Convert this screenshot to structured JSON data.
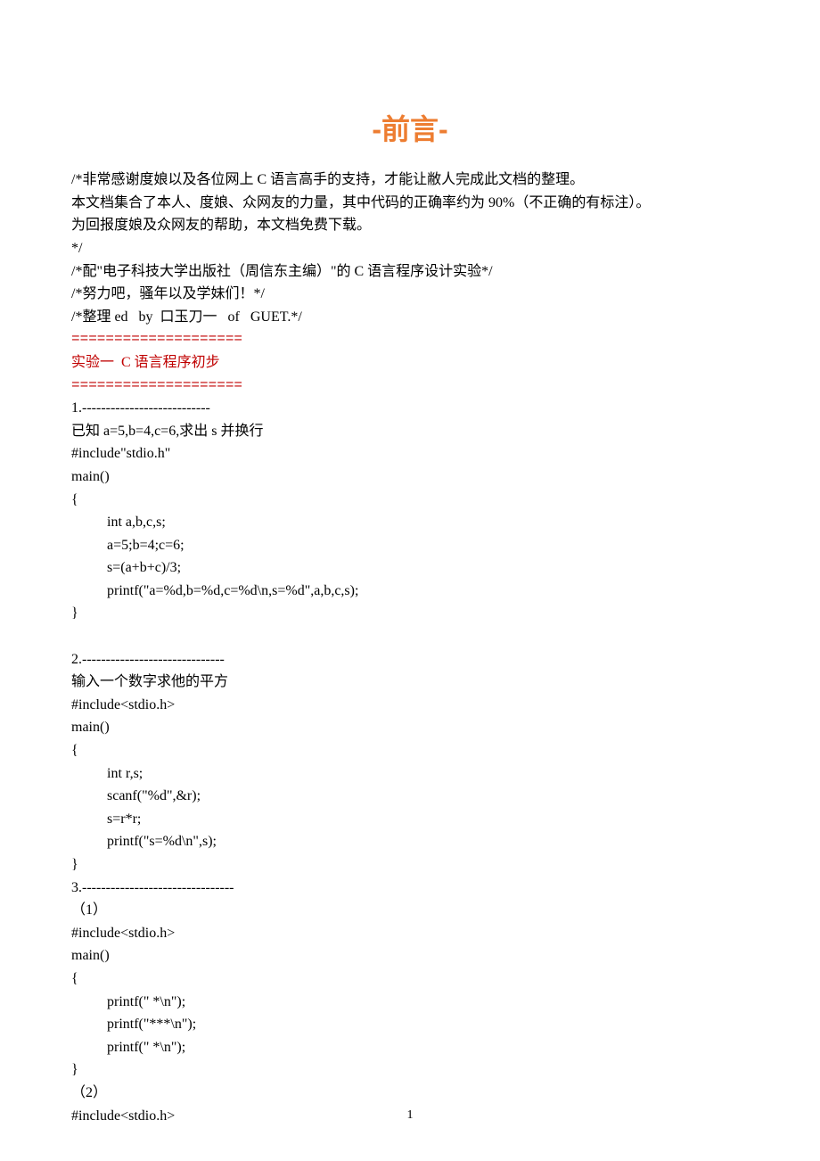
{
  "title": "-前言-",
  "intro": [
    "/*非常感谢度娘以及各位网上 C 语言高手的支持，才能让敝人完成此文档的整理。",
    "本文档集合了本人、度娘、众网友的力量，其中代码的正确率约为 90%（不正确的有标注）。",
    "为回报度娘及众网友的帮助，本文档免费下载。",
    "*/",
    "/*配\"电子科技大学出版社（周信东主编）\"的 C 语言程序设计实验*/",
    "/*努力吧，骚年以及学妹们！*/",
    "/*整理 ed   by  口玉刀一   of   GUET.*/"
  ],
  "sep1": "====================",
  "heading1": "实验一  C 语言程序初步",
  "sep2": "====================",
  "block1": {
    "num": "1.---------------------------",
    "desc": "已知 a=5,b=4,c=6,求出 s 并换行",
    "code": [
      "#include\"stdio.h\"",
      "main()",
      "{",
      "    int a,b,c,s;",
      "    a=5;b=4;c=6;",
      "    s=(a+b+c)/3;",
      "    printf(\"a=%d,b=%d,c=%d\\n,s=%d\",a,b,c,s);",
      "}"
    ]
  },
  "block2": {
    "num": "2.------------------------------",
    "desc": "输入一个数字求他的平方",
    "code": [
      "#include<stdio.h>",
      "main()",
      "{",
      "    int r,s;",
      "    scanf(\"%d\",&r);",
      "    s=r*r;",
      "    printf(\"s=%d\\n\",s);",
      "}"
    ]
  },
  "block3": {
    "num": "3.--------------------------------",
    "sub1": "（1）",
    "code1": [
      "#include<stdio.h>",
      "main()",
      "{",
      "    printf(\" *\\n\");",
      "    printf(\"***\\n\");",
      "    printf(\" *\\n\");",
      "}"
    ],
    "sub2": "（2）",
    "code2": [
      "#include<stdio.h>"
    ]
  },
  "pageNumber": "1"
}
